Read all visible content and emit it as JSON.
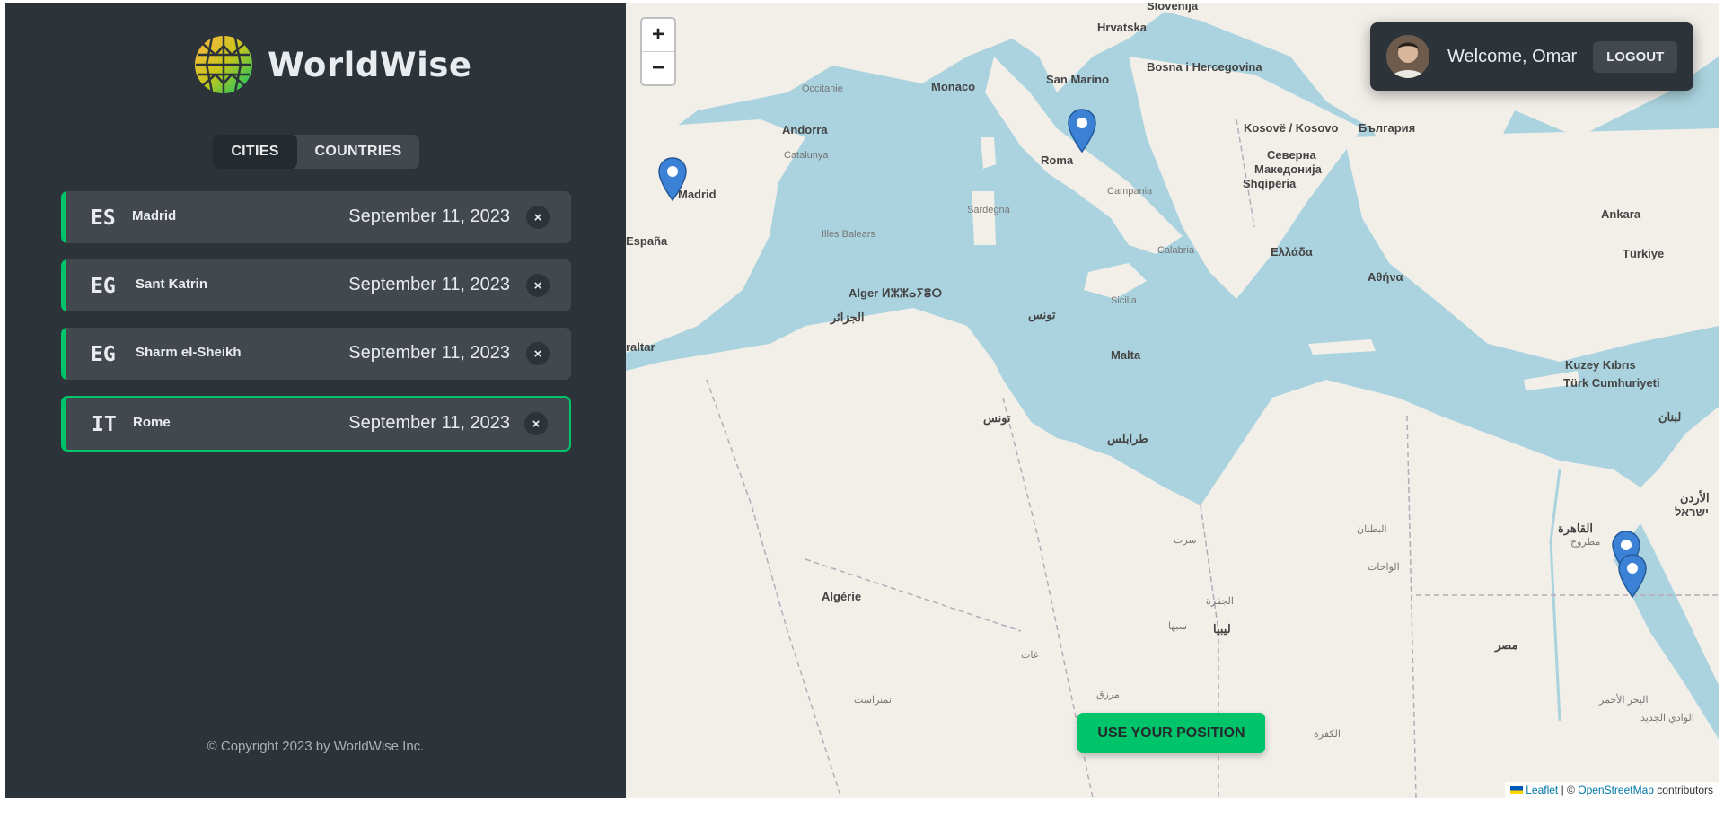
{
  "app": {
    "name": "WorldWise",
    "footer": "© Copyright 2023 by WorldWise Inc."
  },
  "tabs": [
    {
      "label": "CITIES",
      "active": true
    },
    {
      "label": "COUNTRIES",
      "active": false
    }
  ],
  "cities": [
    {
      "code": "ES",
      "name": "Madrid",
      "date": "September 11, 2023",
      "delete": "×",
      "selected": false
    },
    {
      "code": "EG",
      "name": "Sant Katrin",
      "date": "September 11, 2023",
      "delete": "×",
      "selected": false
    },
    {
      "code": "EG",
      "name": "Sharm el-Sheikh",
      "date": "September 11, 2023",
      "delete": "×",
      "selected": false
    },
    {
      "code": "IT",
      "name": "Rome",
      "date": "September 11, 2023",
      "delete": "×",
      "selected": true
    }
  ],
  "map": {
    "zoom_in": "+",
    "zoom_out": "−",
    "user": {
      "welcome": "Welcome, Omar",
      "logout": "LOGOUT"
    },
    "use_position": "USE YOUR POSITION",
    "attribution": {
      "leaflet": "Leaflet",
      "separator": "| ©",
      "osm": "OpenStreetMap",
      "suffix": "contributors"
    },
    "labels": {
      "slovenija": "Slovenija",
      "hrvatska": "Hrvatska",
      "bih": "Bosna i Hercegovina",
      "monaco": "Monaco",
      "san_marino": "San Marino",
      "andorra": "Andorra",
      "kosovo": "Kosovë / Kosovo",
      "bulgaria": "България",
      "roma": "Roma",
      "madrid": "Madrid",
      "espana": "España",
      "severna": "Северна",
      "makedonija": "Македонија",
      "shqiperia": "Shqipëria",
      "ankara": "Ankara",
      "turkiye": "Türkiye",
      "ellada": "Ελλάδα",
      "athina": "Αθήνα",
      "alger": "Alger ⵍⵣⵣⴰⵢⴻⵔ",
      "aljazair": "الجزائر",
      "tunis": "تونس",
      "tunis2": "تونس",
      "malta": "Malta",
      "kuzey1": "Kuzey Kıbrıs",
      "kuzey2": "Türk Cumhuriyeti",
      "tarablus": "طرابلس",
      "lubnan": "لبنان",
      "israel": "ישראל",
      "cairo": "القاهرة",
      "algerie": "Algérie",
      "libya": "ليبيا",
      "misr": "مصر",
      "sardegna": "Sardegna",
      "sicilia": "Sicilia",
      "baleares": "Illes Balears",
      "catalunya": "Catalunya",
      "occitanie": "Occitanie",
      "altar": "raltar",
      "campania": "Campania",
      "calabria": "Calabria",
      "algeria_small": "تمنراست",
      "ghat": "غات",
      "jufra": "الجفرة",
      "sabha": "سبها",
      "murzuq": "مرزق",
      "kufra": "الكفرة",
      "wadi": "الوادي الجديد",
      "albahr": "البحر الأحمر",
      "sirt": "سرت",
      "wahat": "الواحات",
      "butnan": "البطنان",
      "matruh": "مطروح",
      "urdun": "الأردن"
    }
  }
}
